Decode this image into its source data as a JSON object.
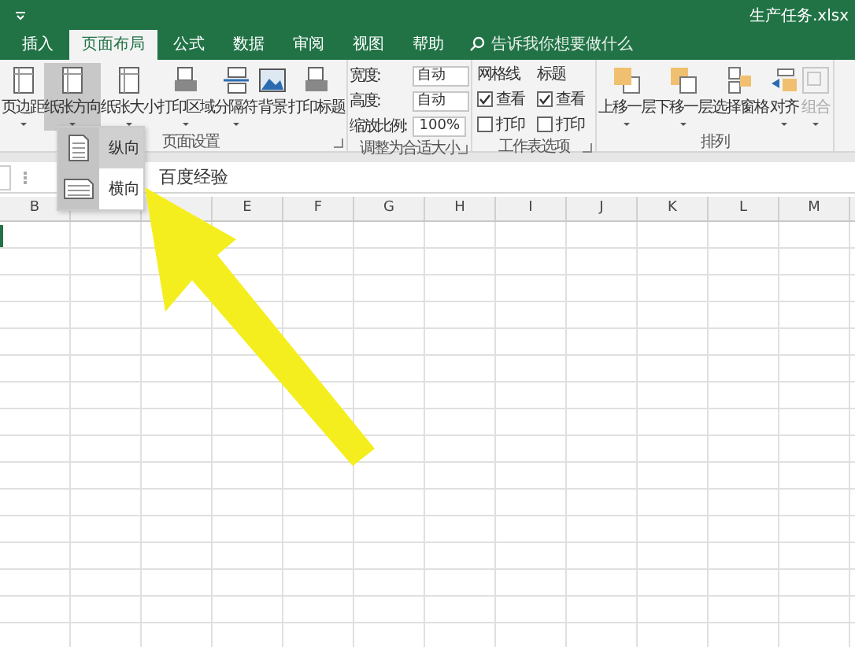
{
  "window": {
    "title": "生产任务.xlsx"
  },
  "tabs": [
    {
      "label": "插入",
      "selected": false
    },
    {
      "label": "页面布局",
      "selected": true
    },
    {
      "label": "公式",
      "selected": false
    },
    {
      "label": "数据",
      "selected": false
    },
    {
      "label": "审阅",
      "selected": false
    },
    {
      "label": "视图",
      "selected": false
    },
    {
      "label": "帮助",
      "selected": false
    }
  ],
  "search": {
    "placeholder": "告诉我你想要做什么"
  },
  "page_setup": {
    "label": "页面设置",
    "buttons": [
      {
        "label": "页边距",
        "dropdown": true,
        "pressed": false
      },
      {
        "label": "纸张方向",
        "dropdown": true,
        "pressed": true
      },
      {
        "label": "纸张大小",
        "dropdown": true,
        "pressed": false
      },
      {
        "label": "打印区域",
        "dropdown": true,
        "pressed": false
      },
      {
        "label": "分隔符",
        "dropdown": true,
        "pressed": false
      },
      {
        "label": "背景",
        "dropdown": false,
        "pressed": false
      },
      {
        "label": "打印标题",
        "dropdown": false,
        "pressed": false
      }
    ]
  },
  "scale_to_fit": {
    "label": "调整为合适大小",
    "fields": [
      {
        "label": "宽度:",
        "value": "自动",
        "kind": "select"
      },
      {
        "label": "高度:",
        "value": "自动",
        "kind": "select"
      },
      {
        "label": "缩放比例:",
        "value": "100%",
        "kind": "spin"
      }
    ]
  },
  "sheet_options": {
    "label": "工作表选项",
    "columns": [
      {
        "title": "网格线",
        "options": [
          {
            "label": "查看",
            "checked": true
          },
          {
            "label": "打印",
            "checked": false
          }
        ]
      },
      {
        "title": "标题",
        "options": [
          {
            "label": "查看",
            "checked": true
          },
          {
            "label": "打印",
            "checked": false
          }
        ]
      }
    ]
  },
  "arrange": {
    "label": "排列",
    "buttons": [
      {
        "label": "上移一层",
        "dropdown": true,
        "disabled": false
      },
      {
        "label": "下移一层",
        "dropdown": true,
        "disabled": false
      },
      {
        "label": "选择窗格",
        "dropdown": false,
        "disabled": false
      },
      {
        "label": "对齐",
        "dropdown": true,
        "disabled": false
      },
      {
        "label": "组合",
        "dropdown": true,
        "disabled": true
      }
    ]
  },
  "orientation_menu": {
    "items": [
      {
        "label": "纵向",
        "selected": true
      },
      {
        "label": "横向",
        "selected": false
      }
    ]
  },
  "formula_bar": {
    "value": "百度经验"
  },
  "column_headers": [
    "B",
    "E",
    "F",
    "G",
    "H",
    "I",
    "J",
    "K",
    "L",
    "M"
  ]
}
